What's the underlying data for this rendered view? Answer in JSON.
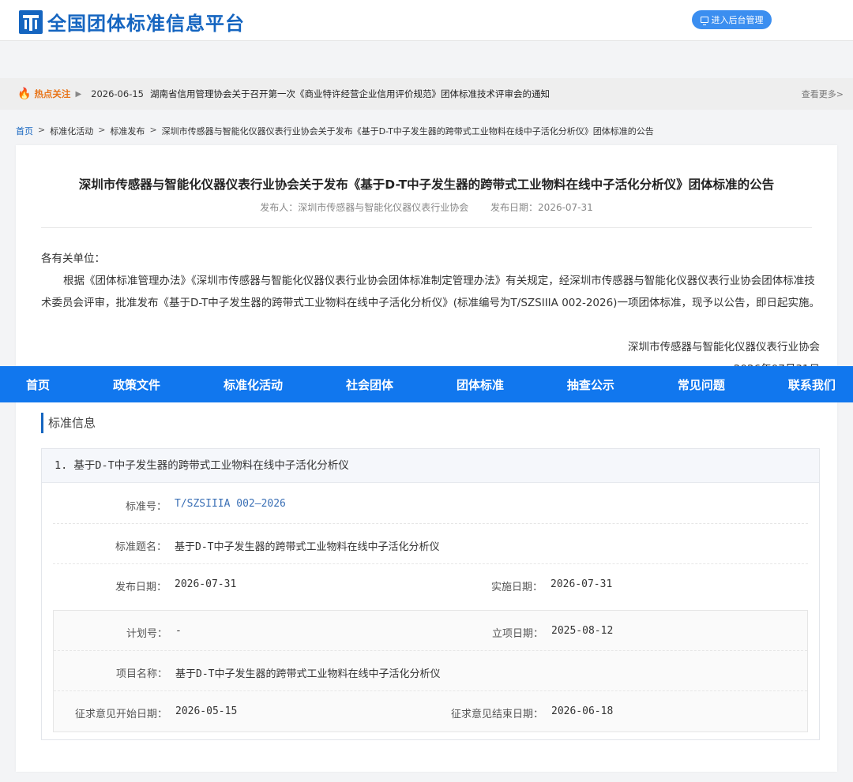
{
  "header": {
    "site_title": "全国团体标准信息平台",
    "admin_button": "进入后台管理"
  },
  "hot": {
    "label": "热点关注",
    "date": "2026-06-15",
    "title": "湖南省信用管理协会关于召开第一次《商业特许经营企业信用评价规范》团体标准技术评审会的通知",
    "more": "查看更多>"
  },
  "breadcrumb": {
    "home": "首页",
    "items": [
      "标准化活动",
      "标准发布",
      "深圳市传感器与智能化仪器仪表行业协会关于发布《基于D-T中子发生器的跨带式工业物料在线中子活化分析仪》团体标准的公告"
    ]
  },
  "article": {
    "title": "深圳市传感器与智能化仪器仪表行业协会关于发布《基于D-T中子发生器的跨带式工业物料在线中子活化分析仪》团体标准的公告",
    "publisher": "发布人：深圳市传感器与智能化仪器仪表行业协会",
    "publish_date": "发布日期：2026-07-31",
    "salutation": "各有关单位：",
    "paragraph": "根据《团体标准管理办法》《深圳市传感器与智能化仪器仪表行业协会团体标准制定管理办法》有关规定，经深圳市传感器与智能化仪器仪表行业协会团体标准技术委员会评审，批准发布《基于D-T中子发生器的跨带式工业物料在线中子活化分析仪》(标准编号为T/SZSIIIA 002-2026)一项团体标准，现予以公告，即日起实施。",
    "signature_org": "深圳市传感器与智能化仪器仪表行业协会",
    "signature_date": "2026年07月31日"
  },
  "nav": [
    "首页",
    "政策文件",
    "标准化活动",
    "社会团体",
    "团体标准",
    "抽查公示",
    "常见问题",
    "联系我们"
  ],
  "standard_info": {
    "section_title": "标准信息",
    "item_title": "1. 基于D-T中子发生器的跨带式工业物料在线中子活化分析仪",
    "std_no_label": "标准号：",
    "std_no": "T/SZSIIIA 002—2026",
    "std_name_label": "标准题名：",
    "std_name": "基于D-T中子发生器的跨带式工业物料在线中子活化分析仪",
    "pub_date_label": "发布日期：",
    "pub_date": "2026-07-31",
    "impl_date_label": "实施日期：",
    "impl_date": "2026-07-31",
    "plan_no_label": "计划号：",
    "plan_no": "-",
    "setup_date_label": "立项日期：",
    "setup_date": "2025-08-12",
    "project_name_label": "项目名称：",
    "project_name": "基于D-T中子发生器的跨带式工业物料在线中子活化分析仪",
    "comment_start_label": "征求意见开始日期：",
    "comment_start": "2026-05-15",
    "comment_end_label": "征求意见结束日期：",
    "comment_end": "2026-06-18"
  },
  "colors": {
    "brand": "#1565c0",
    "nav_bg": "#1177ee",
    "hot_label": "#e8751a"
  }
}
